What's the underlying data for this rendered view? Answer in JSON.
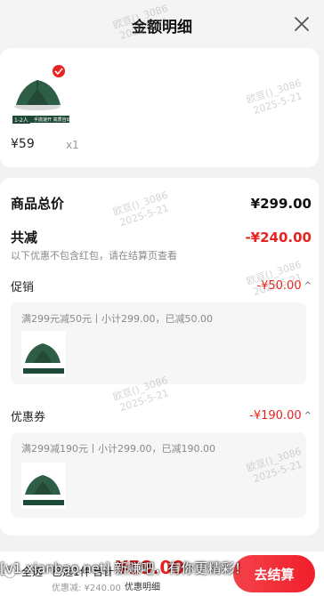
{
  "header": {
    "title": "金额明细",
    "close_icon": "close-icon"
  },
  "product": {
    "price": "¥59",
    "qty": "x1",
    "thumb_tag": "1-2人",
    "thumb_caption": "手拋速开 高质自动帐"
  },
  "summary": {
    "total_label": "商品总价",
    "total_value": "¥299.00",
    "discount_label": "共减",
    "discount_value": "-¥240.00",
    "discount_note": "以下优惠不包含红包，请在结算页查看"
  },
  "promo": {
    "label": "促销",
    "value": "-¥50.00",
    "line": "满299元减50元丨小计299.00，已减50.00"
  },
  "coupon": {
    "label": "优惠券",
    "value": "-¥190.00",
    "line": "满299减190元丨小计299.00，已减190.00"
  },
  "bottom": {
    "select_all": "全选",
    "selected": "已选1件",
    "sum_label": "合计",
    "sum_value": "¥59.00",
    "discounted": "优惠减: ¥240.00",
    "detail_link": "优惠明细",
    "pay_button": "去结算"
  },
  "watermarks": [
    "欧亘()_3086",
    "2025-5-21"
  ],
  "banner_text": "[v1.xianbao.net] 新赚吧，有你更精彩！",
  "colors": {
    "accent_red": "#e8231f",
    "tent_green": "#2f5e46"
  }
}
